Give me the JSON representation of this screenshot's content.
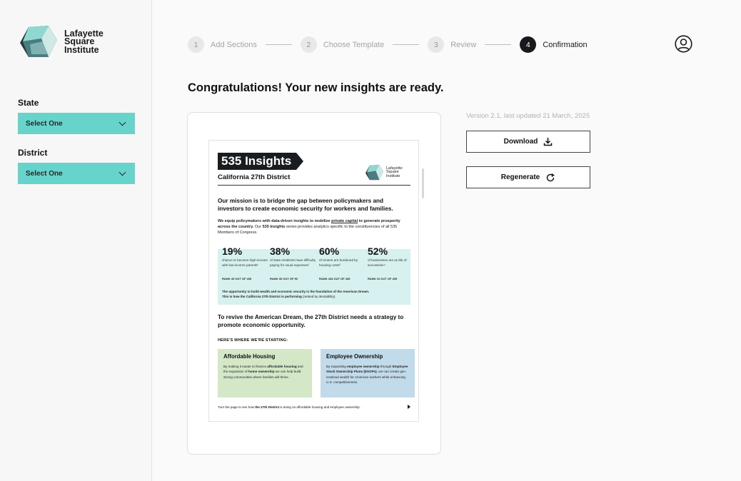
{
  "brand": {
    "name_line1": "Lafayette",
    "name_line2": "Square",
    "name_line3": "Institute"
  },
  "sidebar": {
    "state": {
      "label": "State",
      "value": "Select One"
    },
    "district": {
      "label": "District",
      "value": "Select One"
    }
  },
  "stepper": {
    "steps": [
      {
        "num": "1",
        "label": "Add Sections"
      },
      {
        "num": "2",
        "label": "Choose Template"
      },
      {
        "num": "3",
        "label": "Review"
      },
      {
        "num": "4",
        "label": "Confirmation"
      }
    ],
    "active_step": 4
  },
  "main": {
    "heading": "Congratulations! Your new insights are ready.",
    "version": "Version 2.1, last updated 21 March, 2025",
    "download_label": "Download",
    "regenerate_label": "Regenerate"
  },
  "doc": {
    "title": "535 Insights",
    "subtitle": "California 27th District",
    "logo_line1": "Lafayette",
    "logo_line2": "Square",
    "logo_line3": "Institute",
    "mission": "Our mission is to bridge the gap between policymakers and investors to create economic security for workers and families.",
    "para_bold1": "We equip policymakers with data-driven insights to mobilize ",
    "para_bold2": "private capital",
    "para_bold3": " to generate prosperity across the country.",
    "para_rest1": " Our ",
    "para_bold4": "535 Insights",
    "para_rest2": " series provides analytics specific to the constituencies of all 535 Members of Congress.",
    "stats": [
      {
        "value": "19%",
        "desc": "chance to become high-income with low-income parents¹",
        "rank": "RANK 49 OUT OF 435"
      },
      {
        "value": "38%",
        "desc": "of state residents have difficulty paying for usual expenses²",
        "rank": "RANK 35 OUT OF 50"
      },
      {
        "value": "60%",
        "desc": "of renters are burdened by housing costs³",
        "rank": "RANK 434 OUT OF 435"
      },
      {
        "value": "52%",
        "desc": "of businesses are at risk of succession⁴",
        "rank": "RANK 16 OUT OF 435"
      }
    ],
    "note_line1": "The opportunity to build wealth and economic security is the foundation of the American Dream.",
    "note_line2": "This is how the California 27th District is performing",
    "note_line2_tail": " (ranked by desirability).",
    "revive_1": "To revive the American Dream, ",
    "revive_2": "the 27th District",
    "revive_3": " needs a strategy to promote economic opportunity.",
    "starting": "HERE'S WHERE WE'RE STARTING:",
    "box1": {
      "title": "Affordable Housing",
      "t1": "By making it easier to finance ",
      "b1": "affordable housing",
      "t2": " and the expansion of ",
      "b2": "home ownership",
      "t3": " we can help build strong communities where families will thrive."
    },
    "box2": {
      "title": "Employee Ownership",
      "t1": "By expanding ",
      "b1": "employee ownership",
      "t2": " through ",
      "b2": "Employee Stock Ownership Plans (ESOPs)",
      "t3": ", we can create gen-erational wealth for American workers while enhancing U.S. competitiveness."
    },
    "foot_1": "Turn the page to see how ",
    "foot_2": "the 27th District",
    "foot_3": " is doing on affordable housing and employee ownership."
  },
  "colors": {
    "accent_teal": "#66d4cb",
    "stats_bg": "#d6f1ef",
    "housing_bg": "#d4e8c8",
    "ownership_bg": "#c2dbea",
    "dark": "#17191c"
  },
  "icons": {
    "chevron": "chevron-down-icon",
    "user": "user-circle-icon",
    "download": "download-icon",
    "regenerate": "refresh-icon"
  }
}
